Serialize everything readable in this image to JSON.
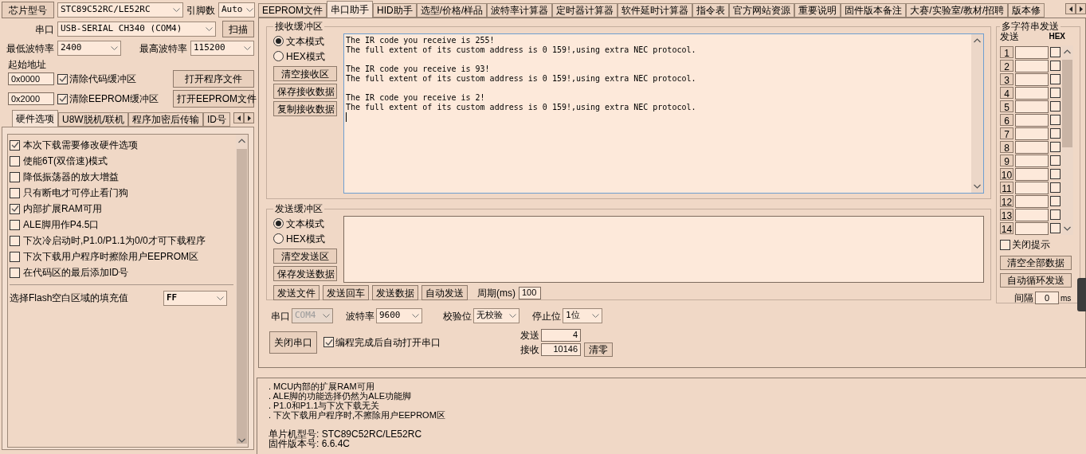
{
  "chip_row": {
    "chip_button": "芯片型号",
    "chip_select": "STC89C52RC/LE52RC",
    "pins_label": "引脚数",
    "pins_select": "Auto"
  },
  "port_row": {
    "label": "串口",
    "select": "USB-SERIAL CH340 (COM4)",
    "scan_button": "扫描"
  },
  "baud_row": {
    "min_label": "最低波特率",
    "min_select": "2400",
    "max_label": "最高波特率",
    "max_select": "115200"
  },
  "start_address": {
    "label": "起始地址",
    "rows": [
      {
        "address": "0x0000",
        "option": "清除代码缓冲区",
        "checked": true,
        "button": "打开程序文件"
      },
      {
        "address": "0x2000",
        "option": "清除EEPROM缓冲区",
        "checked": true,
        "button": "打开EEPROM文件"
      }
    ]
  },
  "left_tabs": [
    {
      "label": "硬件选项",
      "selected": true
    },
    {
      "label": "U8W脱机/联机",
      "selected": false
    },
    {
      "label": "程序加密后传输",
      "selected": false
    },
    {
      "label": "ID号",
      "selected": false
    }
  ],
  "hardware_options": [
    {
      "label": "本次下载需要修改硬件选项",
      "checked": true
    },
    {
      "label": "使能6T(双倍速)模式",
      "checked": false
    },
    {
      "label": "降低振荡器的放大增益",
      "checked": false
    },
    {
      "label": "只有断电才可停止看门狗",
      "checked": false
    },
    {
      "label": "内部扩展RAM可用",
      "checked": true
    },
    {
      "label": "ALE脚用作P4.5口",
      "checked": false
    },
    {
      "label": "下次冷启动时,P1.0/P1.1为0/0才可下载程序",
      "checked": false
    },
    {
      "label": "下次下载用户程序时擦除用户EEPROM区",
      "checked": false
    },
    {
      "label": "在代码区的最后添加ID号",
      "checked": false
    }
  ],
  "fill_value": {
    "label": "选择Flash空白区域的填充值",
    "select": "FF"
  },
  "main_tabs": [
    {
      "label": "EEPROM文件",
      "selected": false
    },
    {
      "label": "串口助手",
      "selected": true
    },
    {
      "label": "HID助手",
      "selected": false
    },
    {
      "label": "选型/价格/样品",
      "selected": false
    },
    {
      "label": "波特率计算器",
      "selected": false
    },
    {
      "label": "定时器计算器",
      "selected": false
    },
    {
      "label": "软件延时计算器",
      "selected": false
    },
    {
      "label": "指令表",
      "selected": false
    },
    {
      "label": "官方网站资源",
      "selected": false
    },
    {
      "label": "重要说明",
      "selected": false
    },
    {
      "label": "固件版本备注",
      "selected": false
    },
    {
      "label": "大赛/实验室/教材/招聘",
      "selected": false
    },
    {
      "label": "版本修",
      "selected": false
    }
  ],
  "receive": {
    "title": "接收缓冲区",
    "modes": [
      {
        "label": "文本模式",
        "selected": true
      },
      {
        "label": "HEX模式",
        "selected": false
      }
    ],
    "buttons": [
      "清空接收区",
      "保存接收数据",
      "复制接收数据"
    ],
    "messages": [
      [
        "The IR code you receive is 255!",
        "The full extent of its custom address is 0 159!,using extra NEC protocol."
      ],
      [
        "The IR code you receive is 93!",
        "The full extent of its custom address is 0 159!,using extra NEC protocol."
      ],
      [
        "The IR code you receive is 2!",
        "The full extent of its custom address is 0 159!,using extra NEC protocol."
      ]
    ]
  },
  "send": {
    "title": "发送缓冲区",
    "modes": [
      {
        "label": "文本模式",
        "selected": true
      },
      {
        "label": "HEX模式",
        "selected": false
      }
    ],
    "buttons": [
      "清空发送区",
      "保存发送数据"
    ],
    "actions": [
      "发送文件",
      "发送回车",
      "发送数据",
      "自动发送"
    ],
    "period_label": "周期(ms)",
    "period": "100"
  },
  "serial": {
    "port_label": "串口",
    "port": "COM4",
    "port_disabled": true,
    "baud_label": "波特率",
    "baud": "9600",
    "parity_label": "校验位",
    "parity": "无校验",
    "stop_label": "停止位",
    "stop": "1位",
    "close_button": "关闭串口",
    "auto_open": {
      "label": "编程完成后自动打开串口",
      "checked": true
    },
    "sent_label": "发送",
    "sent": "4",
    "received_label": "接收",
    "received": "10146",
    "clear_button": "清零"
  },
  "multi_send": {
    "title": "多字符串发送",
    "send_header": "发送",
    "hex_header": "HEX",
    "rows": [
      {
        "number": "1",
        "hex": false
      },
      {
        "number": "2",
        "hex": false
      },
      {
        "number": "3",
        "hex": false
      },
      {
        "number": "4",
        "hex": false
      },
      {
        "number": "5",
        "hex": false
      },
      {
        "number": "6",
        "hex": false
      },
      {
        "number": "7",
        "hex": false
      },
      {
        "number": "8",
        "hex": false
      },
      {
        "number": "9",
        "hex": false
      },
      {
        "number": "10",
        "hex": false
      },
      {
        "number": "11",
        "hex": false
      },
      {
        "number": "12",
        "hex": false
      },
      {
        "number": "13",
        "hex": false
      },
      {
        "number": "14",
        "hex": false
      }
    ],
    "close_hint": {
      "label": "关闭提示",
      "checked": false
    },
    "buttons": [
      "清空全部数据",
      "自动循环发送"
    ],
    "interval_label": "间隔",
    "interval": "0",
    "interval_unit": "ms"
  },
  "log": {
    "notes": [
      ". MCU内部的扩展RAM可用",
      ". ALE脚的功能选择仍然为ALE功能脚",
      ". P1.0和P1.1与下次下载无关",
      ". 下次下载用户程序时,不擦除用户EEPROM区"
    ],
    "info": [
      "单片机型号: STC89C52RC/LE52RC",
      "固件版本号: 6.6.4C"
    ]
  }
}
